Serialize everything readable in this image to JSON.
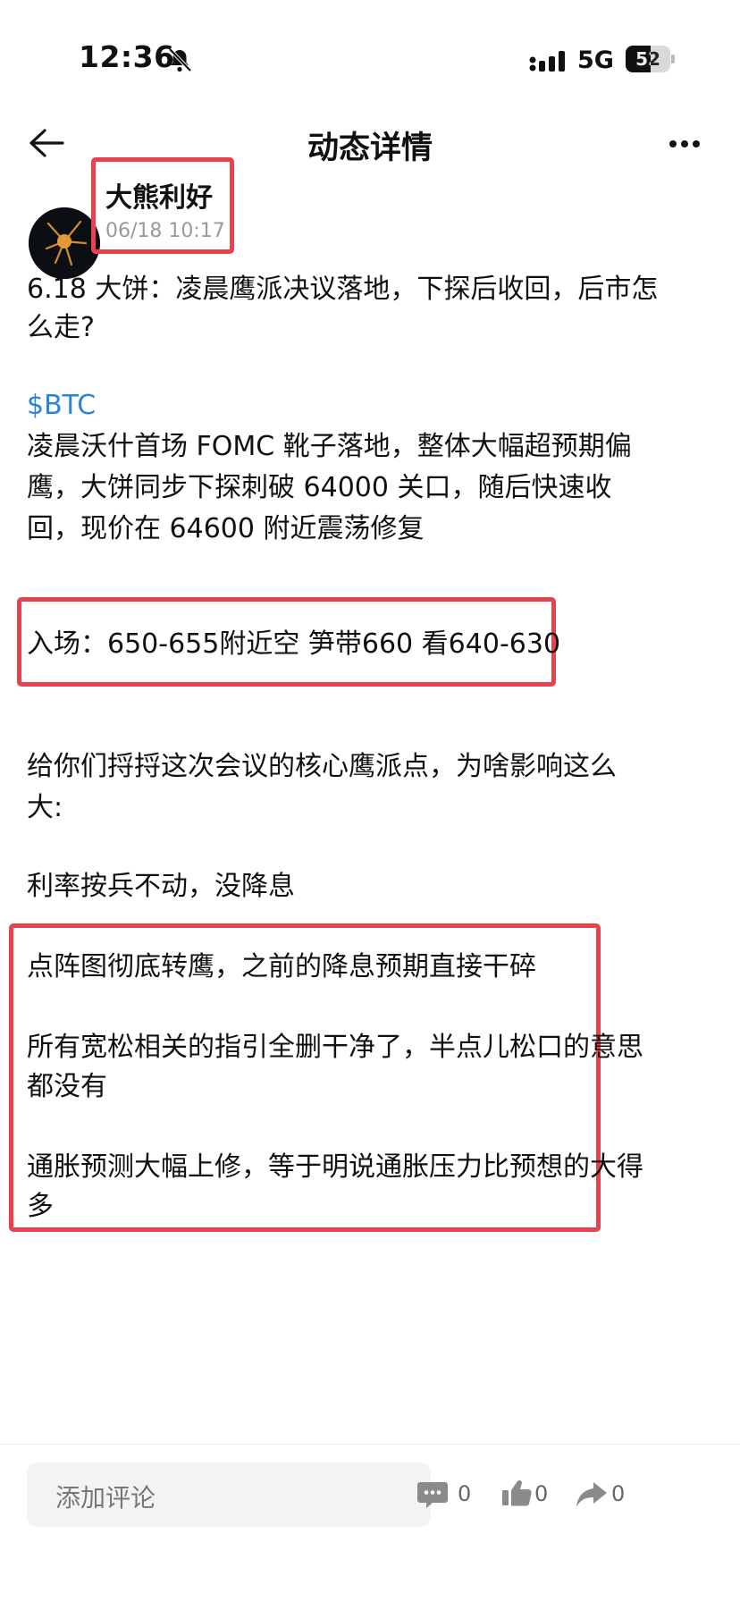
{
  "status_bar": {
    "time": "12:36",
    "network": "5G",
    "battery": "52",
    "icons": [
      "bell-off-icon",
      "signal-icon",
      "battery-icon"
    ]
  },
  "nav": {
    "title": "动态详情",
    "back_icon": "arrow-left-icon",
    "more_icon": "more-horizontal-icon"
  },
  "post": {
    "author": "大熊利好",
    "timestamp": "06/18 10:17",
    "headline": [
      "6.18 大饼：凌晨鹰派决议落地，下探后收回，后市怎",
      "么走?"
    ],
    "ticker": "$BTC",
    "summary": [
      "凌晨沃什首场 FOMC 靴子落地，整体大幅超预期偏",
      "鹰，大饼同步下探刺破 64000 关口，随后快速收",
      "回，现价在 64600 附近震荡修复"
    ],
    "entry": "入场：650-655附近空   笋带660  看640-630",
    "intro": [
      "给你们捋捋这次会议的核心鹰派点，为啥影响这么",
      "大:"
    ],
    "point1": "利率按兵不动，没降息",
    "point2": "点阵图彻底转鹰，之前的降息预期直接干碎",
    "point3": [
      "所有宽松相关的指引全删干净了，半点儿松口的意思",
      "都没有"
    ],
    "point4": [
      "通胀预测大幅上修，等于明说通胀压力比预想的大得",
      "多"
    ]
  },
  "footer": {
    "comment_placeholder": "添加评论",
    "comments_count": "0",
    "likes_count": "0",
    "shares_count": "0"
  },
  "colors": {
    "highlight_box": "#e8424f",
    "link": "#2a84d8"
  }
}
